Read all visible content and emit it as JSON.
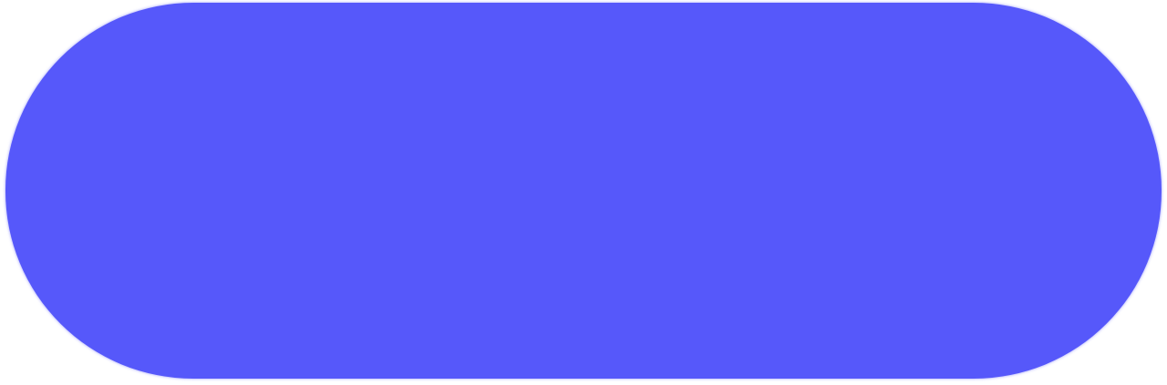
{
  "button": {
    "label": "",
    "color": "#5658FA"
  }
}
